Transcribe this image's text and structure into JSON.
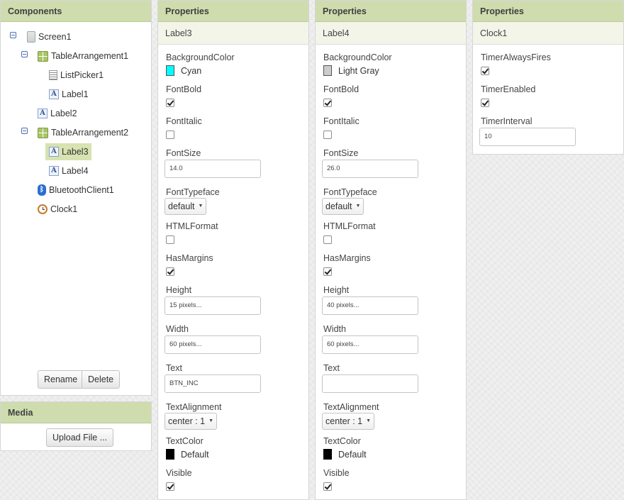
{
  "components": {
    "title": "Components",
    "tree": [
      {
        "label": "Screen1",
        "icon": "screen-icon"
      },
      {
        "label": "TableArrangement1",
        "icon": "table-arrangement-icon"
      },
      {
        "label": "ListPicker1",
        "icon": "list-picker-icon"
      },
      {
        "label": "Label1",
        "icon": "label-icon"
      },
      {
        "label": "Label2",
        "icon": "label-icon"
      },
      {
        "label": "TableArrangement2",
        "icon": "table-arrangement-icon"
      },
      {
        "label": "Label3",
        "icon": "label-icon",
        "selected": true
      },
      {
        "label": "Label4",
        "icon": "label-icon"
      },
      {
        "label": "BluetoothClient1",
        "icon": "bluetooth-icon"
      },
      {
        "label": "Clock1",
        "icon": "clock-icon"
      }
    ],
    "rename_label": "Rename",
    "delete_label": "Delete"
  },
  "media": {
    "title": "Media",
    "upload_label": "Upload File ..."
  },
  "label3": {
    "title": "Properties",
    "component": "Label3",
    "background_color_name": "BackgroundColor",
    "background_color_value": "Cyan",
    "background_color_hex": "#00ffff",
    "font_bold_name": "FontBold",
    "font_bold": true,
    "font_italic_name": "FontItalic",
    "font_italic": false,
    "font_size_name": "FontSize",
    "font_size": "14.0",
    "font_typeface_name": "FontTypeface",
    "font_typeface": "default",
    "html_format_name": "HTMLFormat",
    "html_format": false,
    "has_margins_name": "HasMargins",
    "has_margins": true,
    "height_name": "Height",
    "height": "15 pixels...",
    "width_name": "Width",
    "width": "60 pixels...",
    "text_name": "Text",
    "text": "BTN_INC",
    "text_alignment_name": "TextAlignment",
    "text_alignment": "center : 1",
    "text_color_name": "TextColor",
    "text_color_value": "Default",
    "text_color_hex": "#000000",
    "visible_name": "Visible",
    "visible": true
  },
  "label4": {
    "title": "Properties",
    "component": "Label4",
    "background_color_name": "BackgroundColor",
    "background_color_value": "Light Gray",
    "background_color_hex": "#cccccc",
    "font_bold_name": "FontBold",
    "font_bold": true,
    "font_italic_name": "FontItalic",
    "font_italic": false,
    "font_size_name": "FontSize",
    "font_size": "26.0",
    "font_typeface_name": "FontTypeface",
    "font_typeface": "default",
    "html_format_name": "HTMLFormat",
    "html_format": false,
    "has_margins_name": "HasMargins",
    "has_margins": true,
    "height_name": "Height",
    "height": "40 pixels...",
    "width_name": "Width",
    "width": "60 pixels...",
    "text_name": "Text",
    "text": "",
    "text_alignment_name": "TextAlignment",
    "text_alignment": "center : 1",
    "text_color_name": "TextColor",
    "text_color_value": "Default",
    "text_color_hex": "#000000",
    "visible_name": "Visible",
    "visible": true
  },
  "clock1": {
    "title": "Properties",
    "component": "Clock1",
    "timer_always_fires_name": "TimerAlwaysFires",
    "timer_always_fires": true,
    "timer_enabled_name": "TimerEnabled",
    "timer_enabled": true,
    "timer_interval_name": "TimerInterval",
    "timer_interval": "10"
  }
}
